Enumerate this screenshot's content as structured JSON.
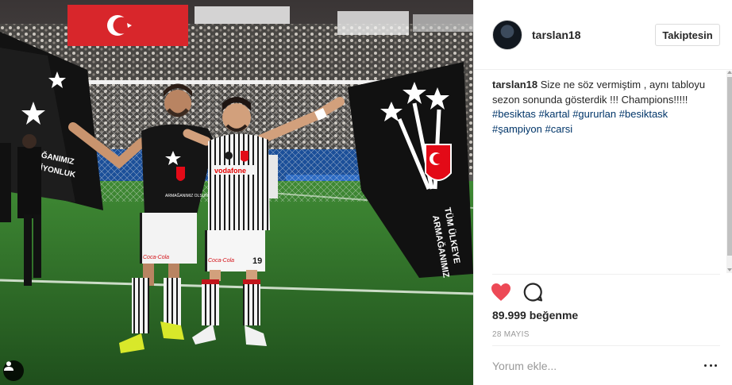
{
  "post": {
    "username": "tarslan18",
    "follow_label": "Takiptesin",
    "caption": {
      "username": "tarslan18",
      "text": "Size ne söz vermiştim , aynı tabloyu sezon sonunda gösterdik !!! Champions!!!!!",
      "hashtags": [
        "#besiktas",
        "#kartal",
        "#gururlan",
        "#besiktask",
        "#şampiyon",
        "#carsi"
      ]
    },
    "likes": "89.999 beğenme",
    "date": "28 MAYIS",
    "comment_placeholder": "Yorum ekle..."
  },
  "photo": {
    "jersey_sponsor_left": "vodafone",
    "shorts_sponsor": "Coca-Cola",
    "player_number": "19"
  },
  "icons": {
    "heart": "heart-icon",
    "comment": "comment-icon",
    "more": "more-options-icon",
    "tag": "user-tag-icon"
  },
  "colors": {
    "heart_red": "#ed4956",
    "hashtag_blue": "#003569",
    "text_dark": "#262626",
    "muted_gray": "#999999",
    "flag_red": "#e30a17",
    "pitch_green": "#2e6a2a"
  }
}
